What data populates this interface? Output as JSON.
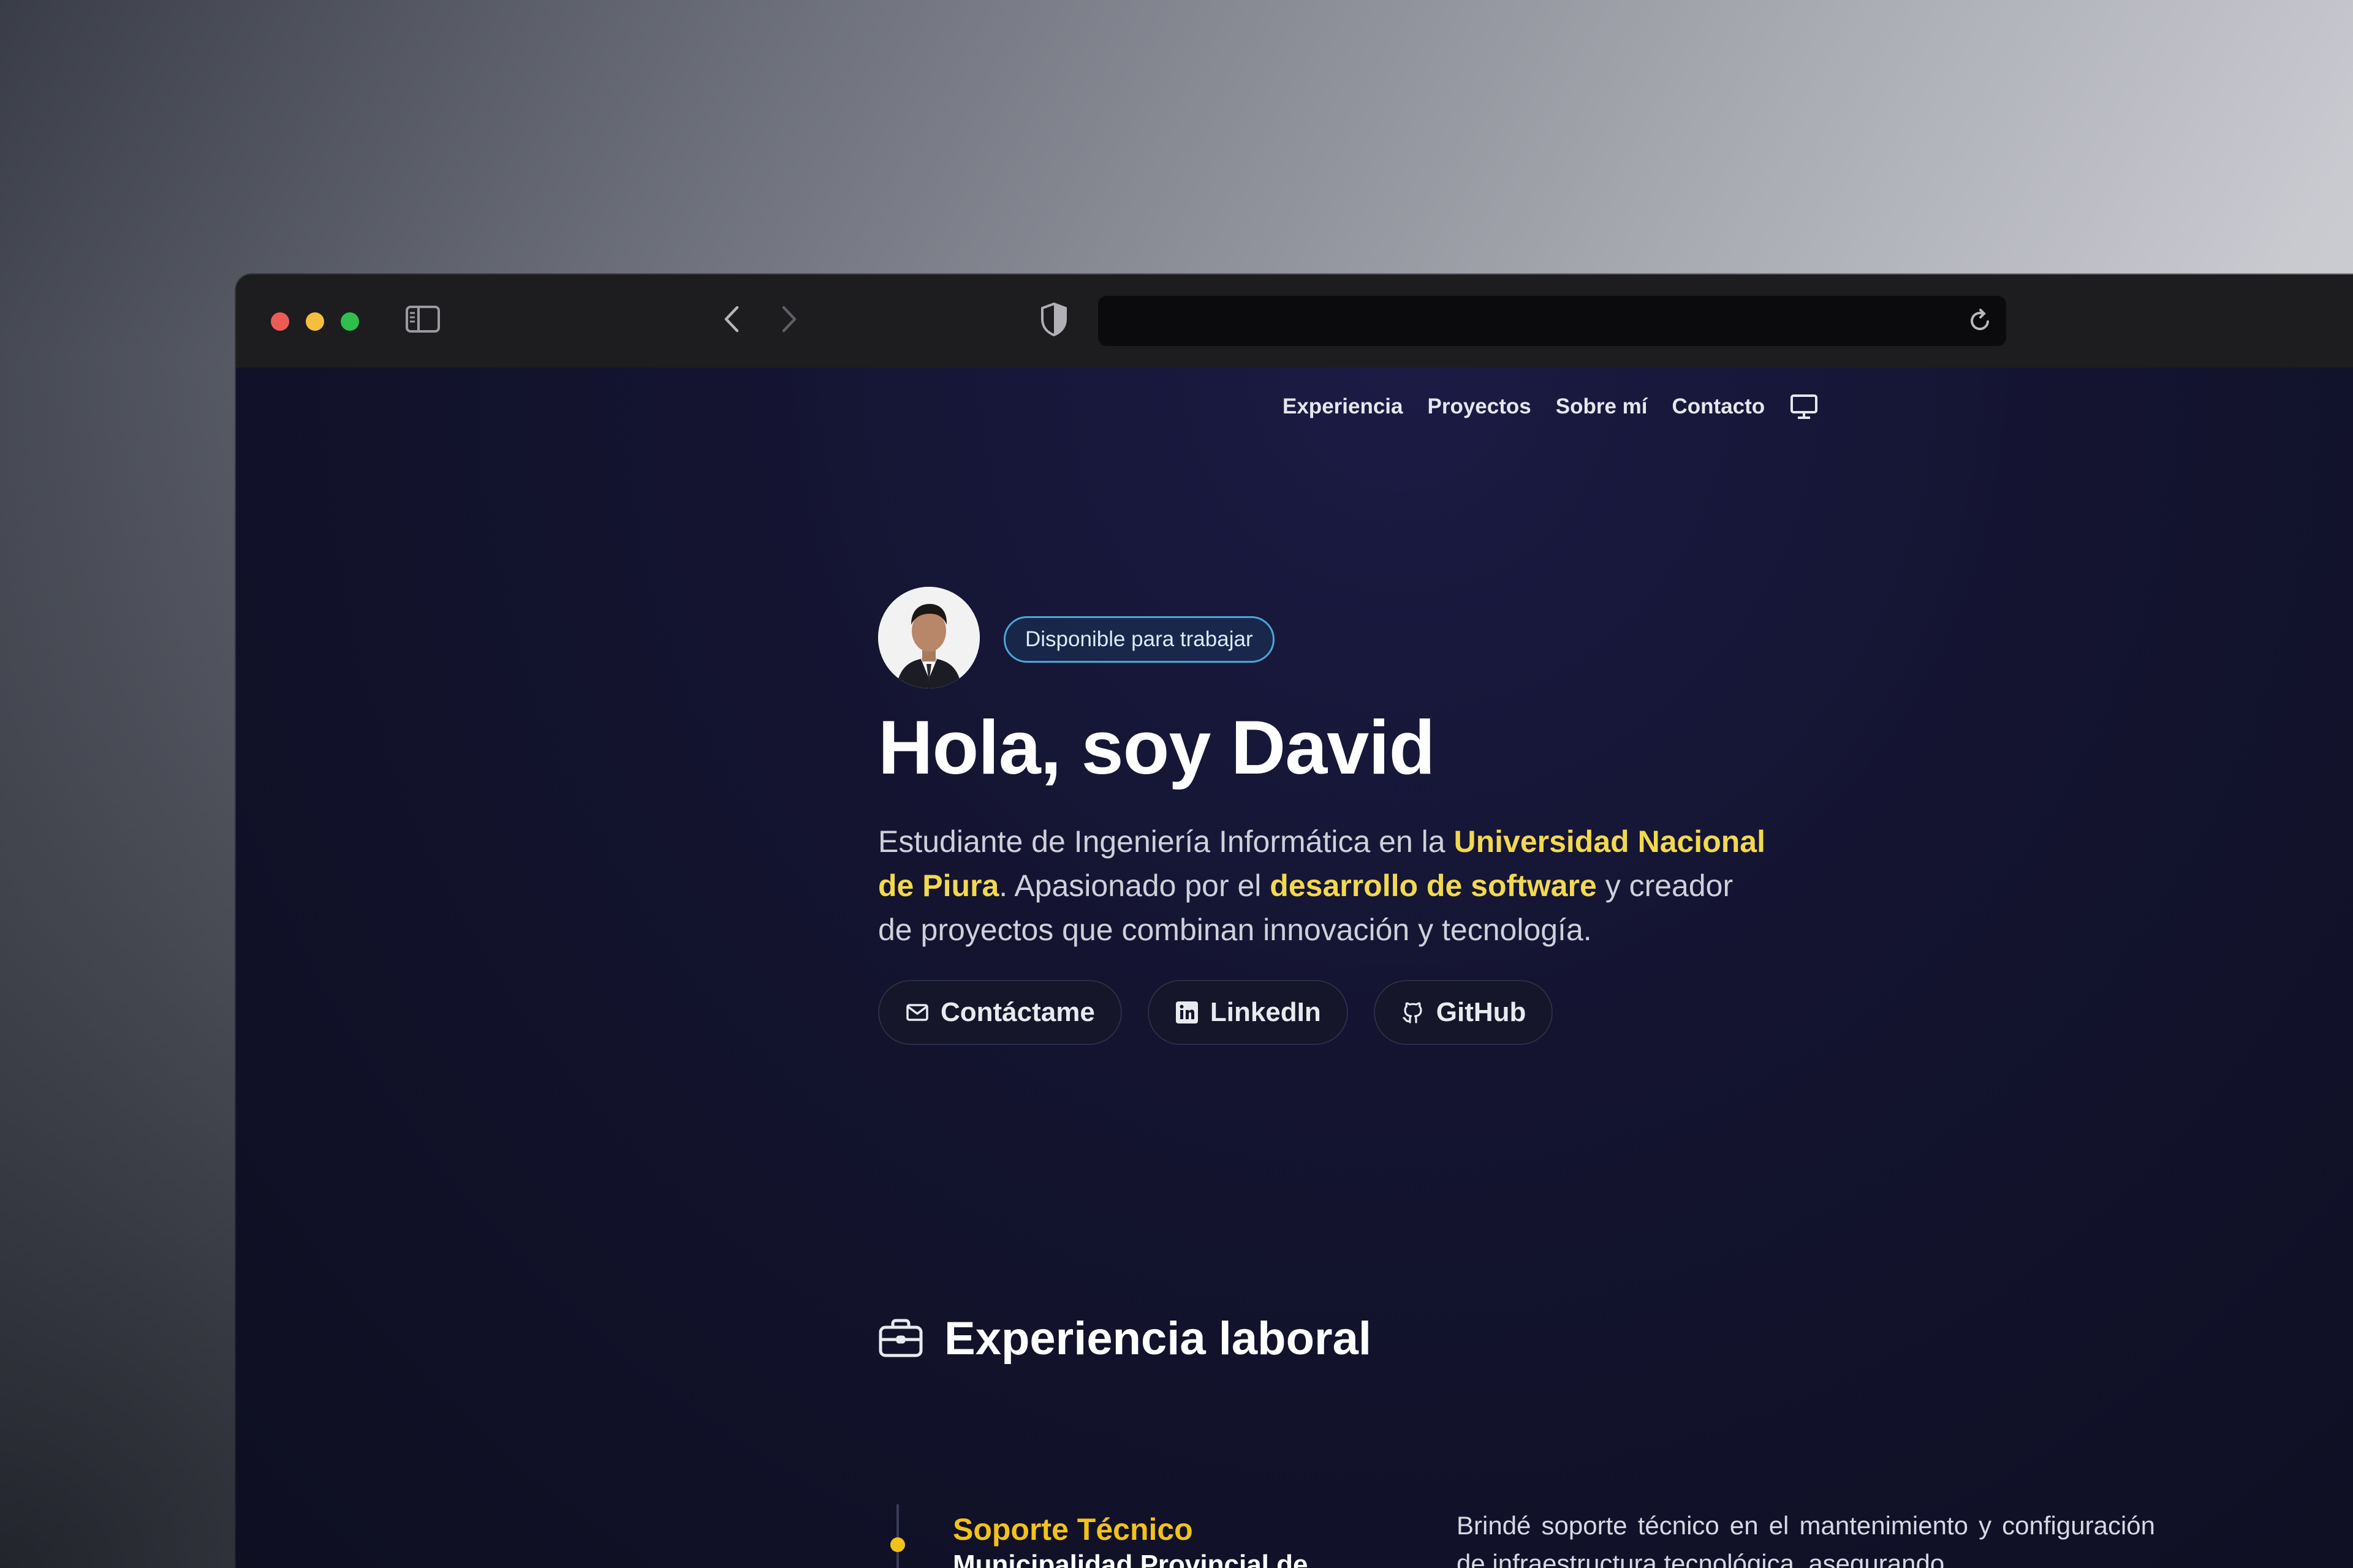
{
  "browser": {
    "traffic_lights": [
      "close",
      "minimize",
      "maximize"
    ],
    "icons": [
      "sidebar-icon",
      "back-icon",
      "forward-icon",
      "shield-icon",
      "reload-icon"
    ],
    "url": ""
  },
  "nav": {
    "items": [
      {
        "label": "Experiencia"
      },
      {
        "label": "Proyectos"
      },
      {
        "label": "Sobre mí"
      },
      {
        "label": "Contacto"
      }
    ],
    "theme_icon": "monitor-icon"
  },
  "hero": {
    "badge": "Disponible para trabajar",
    "title": "Hola, soy David",
    "intro_1": "Estudiante de Ingeniería Informática en la ",
    "intro_hl_1": "Universidad Nacional de Piura",
    "intro_2": ". Apasionado por el ",
    "intro_hl_2": "desarrollo de software",
    "intro_3": " y creador de proyectos que combinan innovación y tecnología.",
    "buttons": [
      {
        "label": "Contáctame",
        "icon": "mail-icon"
      },
      {
        "label": "LinkedIn",
        "icon": "linkedin-icon"
      },
      {
        "label": "GitHub",
        "icon": "github-icon"
      }
    ]
  },
  "experience": {
    "heading": "Experiencia laboral",
    "icon": "briefcase-icon",
    "jobs": [
      {
        "title": "Soporte Técnico",
        "company": "Municipalidad Provincial de",
        "description": "Brindé soporte técnico en el mantenimiento y configuración de infraestructura tecnológica, asegurando"
      }
    ]
  },
  "colors": {
    "accent_yellow": "#f2d94e",
    "badge_border": "#4aa7d6",
    "page_bg": "#141431"
  }
}
